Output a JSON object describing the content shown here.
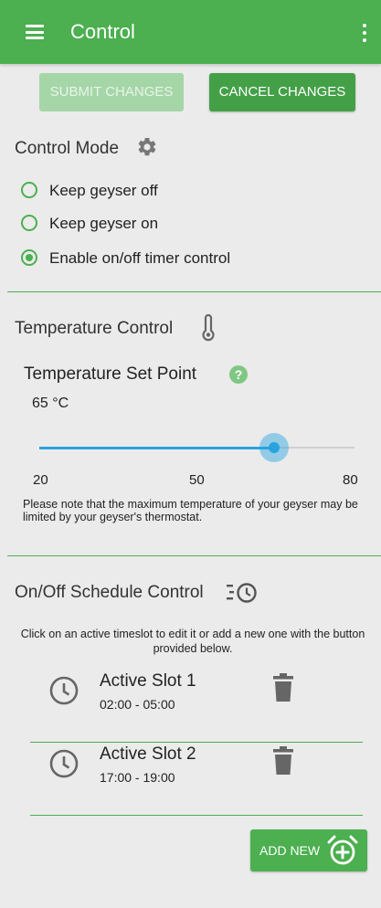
{
  "header": {
    "title": "Control",
    "menu_icon": "hamburger-menu-icon",
    "overflow_icon": "more-vert-icon"
  },
  "actions": {
    "submit_label": "SUBMIT CHANGES",
    "cancel_label": "CANCEL CHANGES"
  },
  "control_mode": {
    "title": "Control Mode",
    "icon": "gear-icon",
    "options": [
      {
        "label": "Keep geyser off",
        "selected": false
      },
      {
        "label": "Keep geyser on",
        "selected": false
      },
      {
        "label": "Enable on/off timer control",
        "selected": true
      }
    ]
  },
  "temperature": {
    "title": "Temperature Control",
    "icon": "thermometer-icon",
    "setpoint_label": "Temperature Set Point",
    "help_icon": "help-icon",
    "value_text": "65 °C",
    "value": 65,
    "min": 20,
    "max": 80,
    "ticks": [
      "20",
      "50",
      "80"
    ],
    "note": "Please note that the maximum temperature of your geyser may be limited by your geyser's thermostat."
  },
  "schedule": {
    "title": "On/Off Schedule Control",
    "icon": "schedule-clock-icon",
    "info": "Click on an active timeslot to edit it or add a new one with the button provided below.",
    "slots": [
      {
        "name": "Active Slot 1",
        "time": "02:00 - 05:00"
      },
      {
        "name": "Active Slot 2",
        "time": "17:00 - 19:00"
      }
    ],
    "add_label": "ADD NEW",
    "add_icon": "add-alarm-icon"
  },
  "colors": {
    "primary": "#4caf50",
    "accent": "#29a3e0",
    "background": "#ebebeb"
  }
}
